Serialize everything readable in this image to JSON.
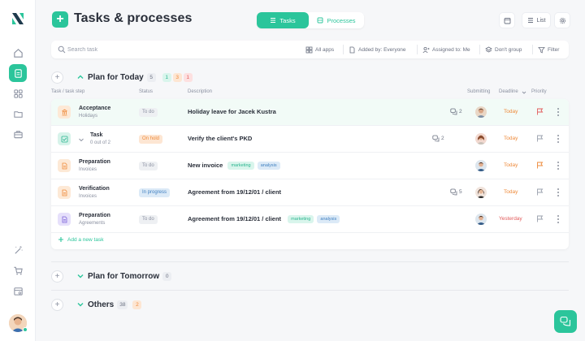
{
  "app": {
    "title": "Tasks & processes",
    "view_toggle": {
      "tasks": "Tasks",
      "processes": "Processes"
    },
    "list_label": "List"
  },
  "filters": {
    "search_placeholder": "Search task",
    "all_apps": "All apps",
    "added_by": "Added by: Everyone",
    "assigned_to": "Assigned to: Me",
    "dont_group": "Don't group",
    "filter": "Filter"
  },
  "groups": {
    "today": {
      "title": "Plan for Today",
      "count": "5",
      "green": "1",
      "orange": "3",
      "red": "1"
    },
    "tomorrow": {
      "title": "Plan for Tomorrow",
      "count": "0"
    },
    "others": {
      "title": "Others",
      "count": "38",
      "orange": "2"
    }
  },
  "columns": {
    "step": "Task / task step",
    "status": "Status",
    "description": "Description",
    "submitting": "Submitting",
    "deadline": "Deadline",
    "priority": "Priority"
  },
  "rows": [
    {
      "title": "Acceptance",
      "sub": "Holidays",
      "status": "To do",
      "desc": "Holiday leave for Jacek Kustra",
      "comments": "2",
      "deadline": "Today",
      "flag_color": "#e25c5c"
    },
    {
      "title": "Task",
      "sub": "0 out of 2",
      "status": "On hold",
      "desc": "Verify the client's PKD",
      "comments": "2",
      "deadline": "Today",
      "flag_color": "#9aa0ad"
    },
    {
      "title": "Preparation",
      "sub": "Invoices",
      "status": "To do",
      "desc": "New invoice",
      "tags": [
        "marketing",
        "analysis"
      ],
      "deadline": "Today",
      "flag_color": "#ee8a3a"
    },
    {
      "title": "Verification",
      "sub": "Invoices",
      "status": "In progress",
      "desc": "Agreement from 19/12/01 / client",
      "comments": "5",
      "deadline": "Today",
      "flag_color": "#9aa0ad"
    },
    {
      "title": "Preparation",
      "sub": "Agreements",
      "status": "To do",
      "desc": "Agreement from 19/12/01 / client",
      "tags": [
        "marketing",
        "analysis"
      ],
      "deadline": "Yesterday",
      "flag_color": "#9aa0ad"
    }
  ],
  "add_task": "Add a new task",
  "colors": {
    "accent": "#2bc59b",
    "orange": "#ee8a3a",
    "red": "#e25c5c"
  }
}
